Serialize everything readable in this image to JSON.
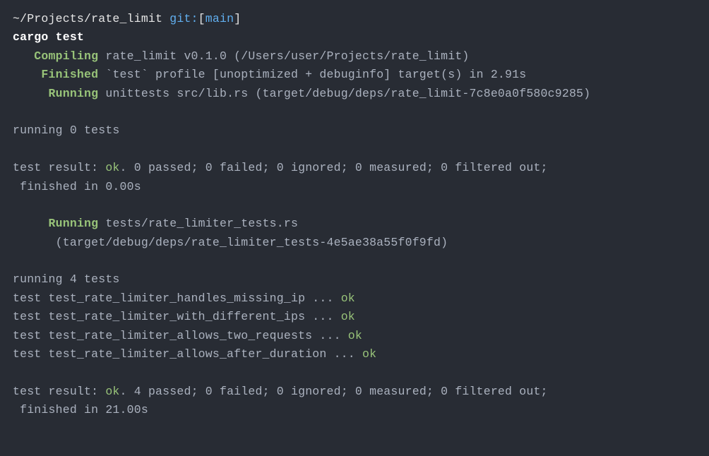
{
  "prompt": {
    "path": "~/Projects/rate_limit",
    "git_label": "git:",
    "branch_open": "[",
    "branch": "main",
    "branch_close": "]"
  },
  "command": "cargo test",
  "compile": {
    "compiling_label": "   Compiling",
    "compiling_text": " rate_limit v0.1.0 (/Users/user/Projects/rate_limit)",
    "finished_label": "    Finished",
    "finished_text": " `test` profile [unoptimized + debuginfo] target(s) in 2.91s",
    "running1_label": "     Running",
    "running1_text": " unittests src/lib.rs (target/debug/deps/rate_limit-7c8e0a0f580c9285)"
  },
  "suite1": {
    "running": "running 0 tests",
    "result_prefix": "test result: ",
    "result_ok": "ok",
    "result_rest": ". 0 passed; 0 failed; 0 ignored; 0 measured; 0 filtered out;",
    "finished": " finished in 0.00s"
  },
  "running2": {
    "label": "     Running",
    "text1": " tests/rate_limiter_tests.rs",
    "text2": "      (target/debug/deps/rate_limiter_tests-4e5ae38a55f0f9fd)"
  },
  "suite2": {
    "running": "running 4 tests",
    "tests": [
      {
        "prefix": "test test_rate_limiter_handles_missing_ip ... ",
        "status": "ok"
      },
      {
        "prefix": "test test_rate_limiter_with_different_ips ... ",
        "status": "ok"
      },
      {
        "prefix": "test test_rate_limiter_allows_two_requests ... ",
        "status": "ok"
      },
      {
        "prefix": "test test_rate_limiter_allows_after_duration ... ",
        "status": "ok"
      }
    ],
    "result_prefix": "test result: ",
    "result_ok": "ok",
    "result_rest": ". 4 passed; 0 failed; 0 ignored; 0 measured; 0 filtered out;",
    "finished": " finished in 21.00s"
  }
}
